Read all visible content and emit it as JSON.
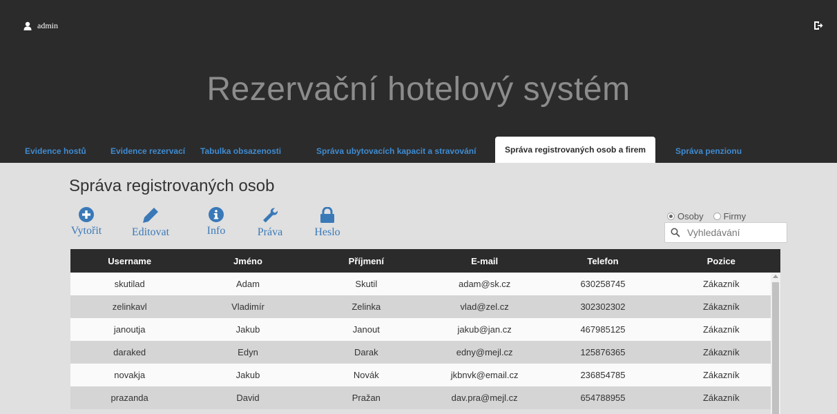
{
  "header": {
    "username": "admin",
    "app_title": "Rezervační hotelový systém"
  },
  "nav": {
    "tabs": [
      {
        "label": "Evidence hostů"
      },
      {
        "label": "Evidence rezervací"
      },
      {
        "label": "Tabulka obsazenosti"
      },
      {
        "label": "Správa ubytovacích kapacit a stravování"
      },
      {
        "label": "Správa registrovaných osob a firem",
        "active": true
      },
      {
        "label": "Správa penzionu"
      }
    ]
  },
  "page": {
    "title": "Správa registrovaných osob",
    "toolbar": {
      "create": "Vytořit",
      "edit": "Editovat",
      "info": "Info",
      "rights": "Práva",
      "password": "Heslo"
    },
    "filter": {
      "persons": "Osoby",
      "companies": "Firmy",
      "selected": "Osoby"
    },
    "search": {
      "placeholder": "Vyhledávání",
      "value": ""
    }
  },
  "table": {
    "headers": [
      "Username",
      "Jméno",
      "Příjmení",
      "E-mail",
      "Telefon",
      "Pozice"
    ],
    "rows": [
      [
        "skutilad",
        "Adam",
        "Skutil",
        "adam@sk.cz",
        "630258745",
        "Zákazník"
      ],
      [
        "zelinkavl",
        "Vladimír",
        "Zelinka",
        "vlad@zel.cz",
        "302302302",
        "Zákazník"
      ],
      [
        "janoutja",
        "Jakub",
        "Janout",
        "jakub@jan.cz",
        "467985125",
        "Zákazník"
      ],
      [
        "daraked",
        "Edyn",
        "Darak",
        "edny@mejl.cz",
        "125876365",
        "Zákazník"
      ],
      [
        "novakja",
        "Jakub",
        "Novák",
        "jkbnvk@email.cz",
        "236854785",
        "Zákazník"
      ],
      [
        "prazanda",
        "David",
        "Pražan",
        "dav.pra@mejl.cz",
        "654788955",
        "Zákazník"
      ]
    ]
  },
  "colors": {
    "header_bg": "#2b2b2b",
    "title_gray": "#8c8c8c",
    "accent_blue": "#3a79b8",
    "content_bg": "#e0e0e0"
  }
}
